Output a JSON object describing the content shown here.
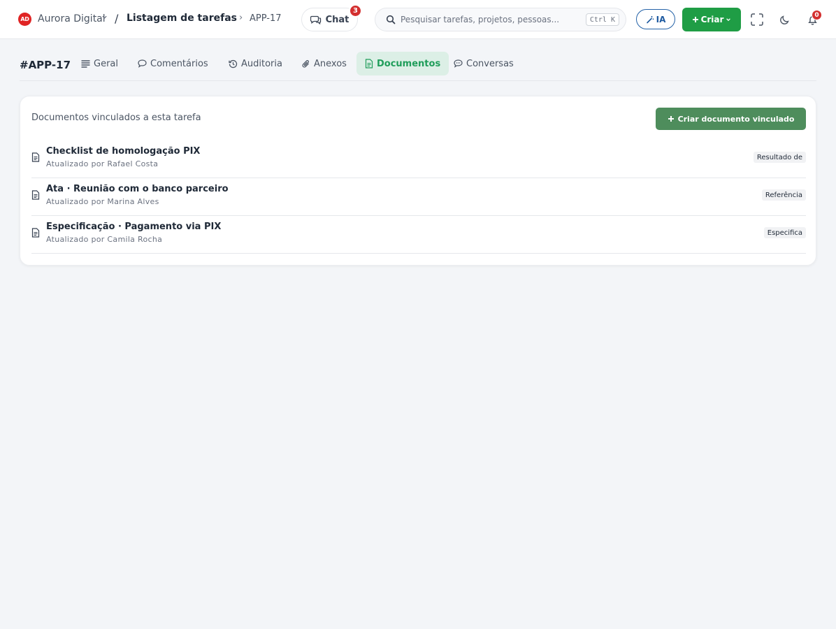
{
  "header": {
    "workspace_initials": "AD",
    "workspace_name": "Aurora Digital",
    "separator": "/",
    "page_title": "Listagem de tarefas",
    "breadcrumb_arrow": "›",
    "task_id": "APP-17",
    "chat_label": "Chat",
    "chat_badge": "3",
    "search_placeholder": "Pesquisar tarefas, projetos, pessoas...",
    "search_shortcut": "Ctrl K",
    "ia_label": "IA",
    "create_label": "Criar",
    "notifications_count": "0"
  },
  "task": {
    "id": "#APP-17",
    "tabs": [
      {
        "label": "Geral",
        "icon": "list-icon",
        "active": false
      },
      {
        "label": "Comentários",
        "icon": "comment-icon",
        "active": false
      },
      {
        "label": "Auditoria",
        "icon": "history-icon",
        "active": false
      },
      {
        "label": "Anexos",
        "icon": "paperclip-icon",
        "active": false
      },
      {
        "label": "Documentos",
        "icon": "document-icon",
        "active": true
      },
      {
        "label": "Conversas",
        "icon": "chat-bubble-icon",
        "active": false
      }
    ]
  },
  "documents": {
    "title": "Documentos vinculados a esta tarefa",
    "create_label": "Criar documento vinculado",
    "items": [
      {
        "title": "Checklist de homologação PIX",
        "meta": "Atualizado por Rafael Costa",
        "relation": "Resultado de"
      },
      {
        "title": "Ata · Reunião com o banco parceiro",
        "meta": "Atualizado por Marina Alves",
        "relation": "Referência"
      },
      {
        "title": "Especificação · Pagamento via PIX",
        "meta": "Atualizado por Camila Rocha",
        "relation": "Especifica"
      }
    ]
  },
  "colors": {
    "brand_green": "#1f9d45",
    "active_tab_bg": "#dcefe6",
    "active_tab_text": "#1f9d5a",
    "badge_red": "#d32f2f",
    "ia_blue": "#2563a8",
    "create_doc_green": "#4e8d5c"
  }
}
